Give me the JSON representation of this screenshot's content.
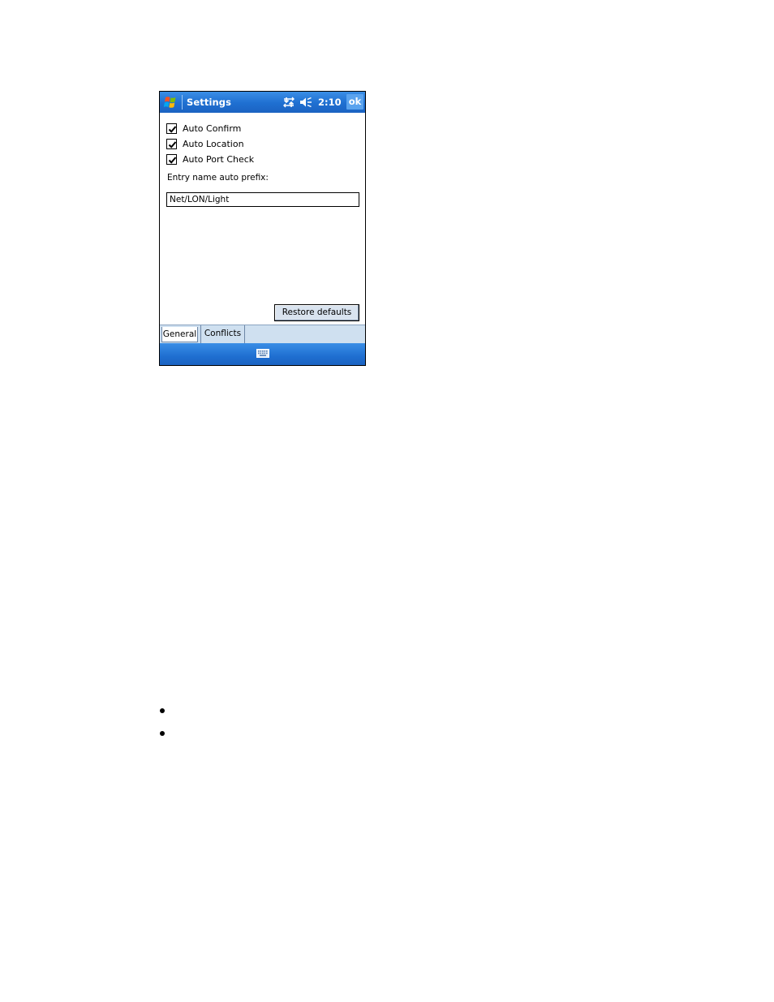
{
  "titlebar": {
    "title": "Settings",
    "clock": "2:10",
    "ok_label": "ok",
    "icons": [
      "windows-start-icon",
      "connectivity-icon",
      "volume-muted-icon"
    ]
  },
  "options": [
    {
      "label": "Auto Confirm",
      "checked": true
    },
    {
      "label": "Auto Location",
      "checked": true
    },
    {
      "label": "Auto Port Check",
      "checked": true
    }
  ],
  "prefix": {
    "label": "Entry name auto prefix:",
    "value": "Net/LON/Light"
  },
  "restore_label": "Restore defaults",
  "tabs": [
    {
      "label": "General",
      "active": true
    },
    {
      "label": "Conflicts",
      "active": false
    }
  ],
  "menubar": {
    "icon": "keyboard-icon"
  },
  "colors": {
    "titlebar_blue": "#1f6fd1",
    "tabstrip": "#cfe0f0",
    "button_face": "#d9e3ef"
  }
}
